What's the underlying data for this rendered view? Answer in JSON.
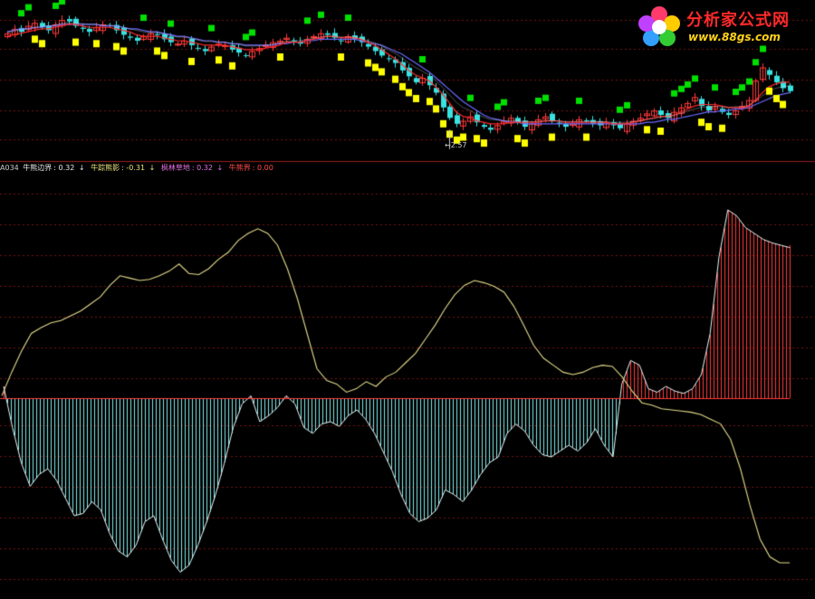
{
  "logo": {
    "title": "分析家公式网",
    "url": "www.88gs.com"
  },
  "price_panel": {
    "low_label": "←2.57"
  },
  "indicator_header": {
    "code": "A034",
    "items": [
      {
        "name": "牛熊边界",
        "value": "0.32",
        "arrow": "↓",
        "color": "#e6e6e6"
      },
      {
        "name": "牛踪熊影",
        "value": "-0.31",
        "arrow": "↓",
        "color": "#e8e07c"
      },
      {
        "name": "枫林草地",
        "value": "0.32",
        "arrow": "↓",
        "color": "#e070e0"
      },
      {
        "name": "牛熊界",
        "value": "0.00",
        "arrow": "",
        "color": "#ff4a4a"
      }
    ]
  },
  "colors": {
    "background": "#000000",
    "grid": "#7a1010",
    "divider": "#9a1c1c",
    "up_candle": "#ff3b3b",
    "down_candle": "#37e3e3",
    "ma_short": "#ff2a2a",
    "ma_long": "#6a6aff",
    "ma_mid": "#e8e8e8",
    "signal_yellow": "#ffff00",
    "signal_green": "#00e000",
    "indicator_line": "#e4dc8a",
    "pos_hist": "#ff3b3b",
    "neg_hist": "#7fe8e8"
  },
  "chart_data": [
    {
      "type": "candlestick",
      "title": "",
      "note": "price panel with moving averages and signal markers",
      "close": [
        3.35,
        3.38,
        3.36,
        3.4,
        3.42,
        3.39,
        3.37,
        3.41,
        3.44,
        3.43,
        3.4,
        3.38,
        3.36,
        3.39,
        3.41,
        3.4,
        3.37,
        3.34,
        3.32,
        3.3,
        3.33,
        3.35,
        3.34,
        3.31,
        3.29,
        3.28,
        3.3,
        3.27,
        3.25,
        3.23,
        3.26,
        3.28,
        3.27,
        3.24,
        3.22,
        3.2,
        3.23,
        3.25,
        3.27,
        3.29,
        3.3,
        3.32,
        3.3,
        3.28,
        3.31,
        3.33,
        3.35,
        3.34,
        3.32,
        3.3,
        3.33,
        3.31,
        3.29,
        3.26,
        3.23,
        3.2,
        3.18,
        3.15,
        3.1,
        3.06,
        3.02,
        3.05,
        3.0,
        2.95,
        2.85,
        2.78,
        2.74,
        2.76,
        2.79,
        2.75,
        2.72,
        2.7,
        2.73,
        2.76,
        2.78,
        2.75,
        2.72,
        2.74,
        2.77,
        2.79,
        2.76,
        2.74,
        2.72,
        2.74,
        2.77,
        2.76,
        2.74,
        2.73,
        2.75,
        2.73,
        2.71,
        2.74,
        2.76,
        2.78,
        2.81,
        2.83,
        2.8,
        2.78,
        2.82,
        2.85,
        2.88,
        2.92,
        2.86,
        2.83,
        2.86,
        2.82,
        2.8,
        2.83,
        2.86,
        2.9,
        3.03,
        3.12,
        3.07,
        3.02,
        2.98,
        2.96
      ],
      "ma_short": [
        3.33,
        3.34,
        3.35,
        3.36,
        3.37,
        3.38,
        3.38,
        3.39,
        3.4,
        3.41,
        3.41,
        3.4,
        3.39,
        3.39,
        3.39,
        3.39,
        3.38,
        3.37,
        3.36,
        3.34,
        3.33,
        3.33,
        3.33,
        3.32,
        3.31,
        3.3,
        3.3,
        3.29,
        3.28,
        3.27,
        3.27,
        3.27,
        3.27,
        3.26,
        3.25,
        3.24,
        3.24,
        3.24,
        3.25,
        3.26,
        3.27,
        3.29,
        3.29,
        3.29,
        3.3,
        3.31,
        3.32,
        3.33,
        3.33,
        3.32,
        3.32,
        3.32,
        3.31,
        3.29,
        3.27,
        3.24,
        3.21,
        3.18,
        3.14,
        3.1,
        3.07,
        3.05,
        3.03,
        2.99,
        2.94,
        2.88,
        2.82,
        2.79,
        2.78,
        2.76,
        2.75,
        2.74,
        2.74,
        2.74,
        2.75,
        2.75,
        2.75,
        2.75,
        2.75,
        2.76,
        2.76,
        2.76,
        2.75,
        2.75,
        2.75,
        2.75,
        2.75,
        2.75,
        2.75,
        2.74,
        2.74,
        2.74,
        2.75,
        2.76,
        2.77,
        2.78,
        2.79,
        2.79,
        2.8,
        2.82,
        2.84,
        2.86,
        2.87,
        2.87,
        2.87,
        2.86,
        2.85,
        2.85,
        2.85,
        2.86,
        2.9,
        2.95,
        2.99,
        3.01,
        3.02,
        3.02
      ],
      "ma_long": [
        3.36,
        3.37,
        3.38,
        3.38,
        3.39,
        3.39,
        3.4,
        3.4,
        3.41,
        3.41,
        3.41,
        3.41,
        3.41,
        3.41,
        3.4,
        3.4,
        3.4,
        3.39,
        3.38,
        3.38,
        3.37,
        3.36,
        3.36,
        3.35,
        3.34,
        3.33,
        3.33,
        3.32,
        3.31,
        3.3,
        3.3,
        3.29,
        3.29,
        3.28,
        3.28,
        3.27,
        3.27,
        3.27,
        3.27,
        3.27,
        3.28,
        3.28,
        3.29,
        3.29,
        3.3,
        3.3,
        3.31,
        3.31,
        3.31,
        3.31,
        3.31,
        3.31,
        3.3,
        3.29,
        3.28,
        3.27,
        3.25,
        3.23,
        3.21,
        3.18,
        3.15,
        3.12,
        3.09,
        3.05,
        3.01,
        2.97,
        2.93,
        2.89,
        2.86,
        2.83,
        2.8,
        2.78,
        2.77,
        2.76,
        2.75,
        2.75,
        2.74,
        2.74,
        2.74,
        2.74,
        2.74,
        2.74,
        2.74,
        2.74,
        2.74,
        2.74,
        2.74,
        2.74,
        2.74,
        2.74,
        2.74,
        2.74,
        2.74,
        2.74,
        2.75,
        2.75,
        2.76,
        2.77,
        2.77,
        2.78,
        2.79,
        2.8,
        2.81,
        2.82,
        2.82,
        2.83,
        2.83,
        2.84,
        2.84,
        2.85,
        2.87,
        2.89,
        2.91,
        2.93,
        2.94,
        2.95
      ],
      "low_point": 2.57
    },
    {
      "type": "line",
      "title": "",
      "series": [
        {
          "name": "牛熊边界",
          "kind": "line",
          "values": [
            0.05,
            -0.02,
            -0.1,
            -0.18,
            -0.26,
            -0.32,
            -0.36,
            -0.4,
            -0.33,
            -0.28,
            -0.45,
            -0.55,
            -0.62,
            -0.7,
            -0.58,
            -0.5,
            -0.62,
            -0.78,
            -0.92,
            -1.02,
            -1.1,
            -0.98,
            -0.85,
            -1.0,
            -1.18,
            -1.25,
            -1.2,
            -1.05,
            -0.9,
            -0.85,
            -1.05,
            -1.22,
            -1.3,
            -1.2,
            -1.05,
            -0.82,
            -0.6,
            -0.32,
            -0.1,
            0.04,
            -0.08,
            -0.2,
            -0.05,
            0.02,
            -0.15,
            -0.22,
            -0.08,
            0.01,
            -0.04,
            -0.14,
            -0.28,
            -0.46,
            -0.62,
            -0.75,
            -0.82,
            -0.95,
            -1.05,
            -1.08,
            -1.0,
            -0.9,
            -0.82,
            -0.78,
            -0.75,
            -0.72,
            -0.68,
            -0.62,
            -0.55,
            -0.48,
            -0.42,
            -0.38,
            -0.3,
            -0.24,
            -0.2,
            -0.26,
            -0.35,
            -0.4,
            -0.38,
            -0.32,
            -0.3,
            -0.36,
            -0.4,
            -0.32,
            -0.25,
            -0.3,
            -0.38,
            -0.3,
            -0.1,
            0.06,
            0.22,
            0.32,
            0.22,
            0.06,
            0.1,
            0.05,
            0.12,
            0.04,
            0.08,
            0.2,
            0.4,
            0.8,
            1.4,
            1.6,
            1.55,
            1.45,
            1.35,
            1.35,
            1.3,
            1.28,
            1.25,
            1.22,
            1.2,
            1.18,
            1.15,
            1.12,
            1.1,
            1.08
          ]
        },
        {
          "name": "牛踪熊影",
          "kind": "line",
          "values": [
            0.02,
            0.22,
            0.4,
            0.55,
            0.6,
            0.64,
            0.66,
            0.7,
            0.74,
            0.8,
            0.86,
            0.96,
            1.04,
            1.02,
            1.0,
            1.01,
            1.04,
            1.08,
            1.14,
            1.06,
            1.05,
            1.1,
            1.18,
            1.24,
            1.34,
            1.4,
            1.44,
            1.4,
            1.3,
            1.1,
            0.85,
            0.55,
            0.25,
            0.15,
            0.12,
            0.05,
            0.08,
            0.14,
            0.1,
            0.18,
            0.22,
            0.3,
            0.38,
            0.5,
            0.62,
            0.76,
            0.88,
            0.96,
            1.0,
            0.98,
            0.95,
            0.9,
            0.78,
            0.62,
            0.45,
            0.34,
            0.28,
            0.22,
            0.2,
            0.22,
            0.26,
            0.28,
            0.27,
            0.18,
            0.06,
            -0.04,
            -0.06,
            -0.09,
            -0.1,
            -0.11,
            -0.12,
            -0.14,
            -0.18,
            -0.22,
            -0.35,
            -0.6,
            -0.92,
            -1.2,
            -1.35,
            -1.4,
            -1.4
          ]
        },
        {
          "name": "枫林草地",
          "kind": "histogram",
          "values": [
            0.1,
            -0.25,
            -0.55,
            -0.75,
            -0.65,
            -0.6,
            -0.7,
            -0.85,
            -1.0,
            -0.98,
            -0.88,
            -0.95,
            -1.15,
            -1.3,
            -1.35,
            -1.25,
            -1.05,
            -1.0,
            -1.2,
            -1.38,
            -1.48,
            -1.42,
            -1.25,
            -1.05,
            -0.82,
            -0.55,
            -0.25,
            -0.05,
            0.02,
            -0.2,
            -0.15,
            -0.08,
            0.02,
            -0.05,
            -0.25,
            -0.3,
            -0.22,
            -0.2,
            -0.24,
            -0.15,
            -0.1,
            -0.18,
            -0.3,
            -0.46,
            -0.62,
            -0.82,
            -0.98,
            -1.05,
            -1.02,
            -0.95,
            -0.78,
            -0.82,
            -0.88,
            -0.78,
            -0.65,
            -0.55,
            -0.5,
            -0.3,
            -0.22,
            -0.28,
            -0.4,
            -0.48,
            -0.5,
            -0.45,
            -0.4,
            -0.45,
            -0.38,
            -0.26,
            -0.4,
            -0.5,
            0.12,
            0.32,
            0.28,
            0.08,
            0.05,
            0.1,
            0.06,
            0.04,
            0.08,
            0.2,
            0.55,
            1.2,
            1.6,
            1.55,
            1.45,
            1.4,
            1.35,
            1.32,
            1.3,
            1.28
          ]
        }
      ],
      "zero_line": 0.0
    }
  ]
}
